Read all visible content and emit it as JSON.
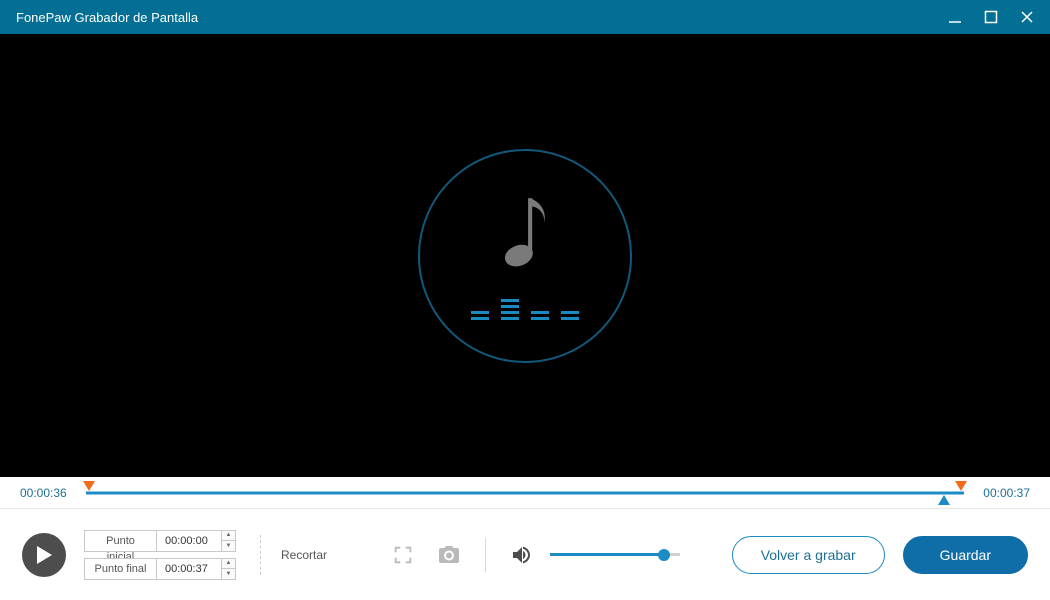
{
  "window": {
    "title": "FonePaw Grabador de Pantalla"
  },
  "timeline": {
    "current_time": "00:00:36",
    "total_time": "00:00:37"
  },
  "trim": {
    "start_label": "Punto inicial",
    "start_value": "00:00:00",
    "end_label": "Punto final",
    "end_value": "00:00:37",
    "action_label": "Recortar"
  },
  "volume": {
    "percent": 88
  },
  "buttons": {
    "re_record": "Volver a grabar",
    "save": "Guardar"
  },
  "colors": {
    "accent": "#1d8bc4",
    "titlebar": "#036f95",
    "marker": "#f26b1d",
    "save_bg": "#0f6ea8"
  }
}
